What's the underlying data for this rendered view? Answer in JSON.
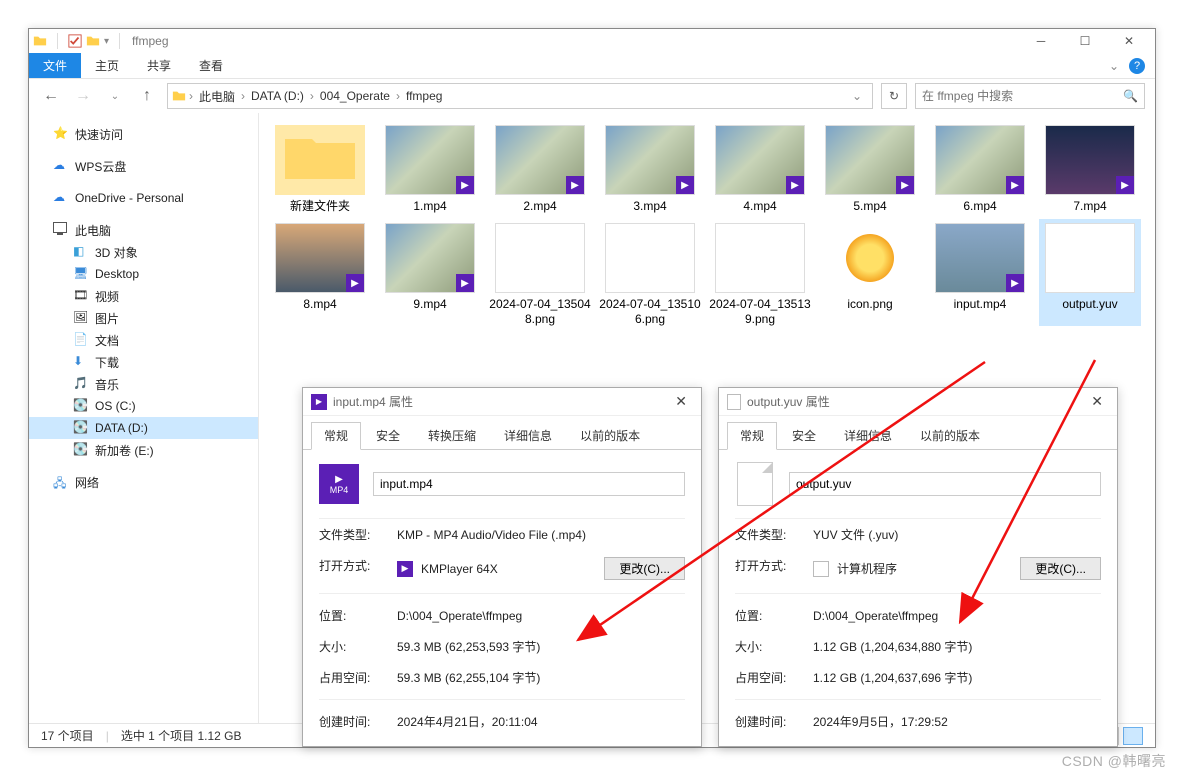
{
  "window": {
    "title": "ffmpeg"
  },
  "ribbon": {
    "file": "文件",
    "home": "主页",
    "share": "共享",
    "view": "查看"
  },
  "breadcrumb": {
    "this_pc": "此电脑",
    "drive": "DATA (D:)",
    "folder1": "004_Operate",
    "folder2": "ffmpeg"
  },
  "search": {
    "placeholder": "在 ffmpeg 中搜索"
  },
  "sidebar": {
    "quick": "快速访问",
    "wps": "WPS云盘",
    "onedrive": "OneDrive - Personal",
    "this_pc": "此电脑",
    "obj3d": "3D 对象",
    "desktop": "Desktop",
    "videos": "视频",
    "pictures": "图片",
    "documents": "文档",
    "downloads": "下载",
    "music": "音乐",
    "os_c": "OS (C:)",
    "data_d": "DATA (D:)",
    "new_e": "新加卷 (E:)",
    "network": "网络"
  },
  "files": {
    "new_folder": "新建文件夹",
    "f1": "1.mp4",
    "f2": "2.mp4",
    "f3": "3.mp4",
    "f4": "4.mp4",
    "f5": "5.mp4",
    "f6": "6.mp4",
    "f7": "7.mp4",
    "f8": "8.mp4",
    "f9": "9.mp4",
    "p1": "2024-07-04_135048.png",
    "p2": "2024-07-04_135106.png",
    "p3": "2024-07-04_135139.png",
    "icon": "icon.png",
    "input": "input.mp4",
    "output": "output.yuv"
  },
  "status": {
    "count": "17 个项目",
    "selected": "选中 1 个项目  1.12 GB"
  },
  "prop_input": {
    "title": "input.mp4 属性",
    "tabs": {
      "general": "常规",
      "security": "安全",
      "compress": "转换压缩",
      "details": "详细信息",
      "prev": "以前的版本"
    },
    "filename": "input.mp4",
    "type_k": "文件类型:",
    "type_v": "KMP - MP4 Audio/Video File (.mp4)",
    "open_k": "打开方式:",
    "open_v": "KMPlayer 64X",
    "change": "更改(C)...",
    "loc_k": "位置:",
    "loc_v": "D:\\004_Operate\\ffmpeg",
    "size_k": "大小:",
    "size_v": "59.3 MB (62,253,593 字节)",
    "disk_k": "占用空间:",
    "disk_v": "59.3 MB (62,255,104 字节)",
    "created_k": "创建时间:",
    "created_v": "2024年4月21日，20:11:04"
  },
  "prop_output": {
    "title": "output.yuv 属性",
    "tabs": {
      "general": "常规",
      "security": "安全",
      "details": "详细信息",
      "prev": "以前的版本"
    },
    "filename": "output.yuv",
    "type_k": "文件类型:",
    "type_v": "YUV 文件 (.yuv)",
    "open_k": "打开方式:",
    "open_v": "计算机程序",
    "change": "更改(C)...",
    "loc_k": "位置:",
    "loc_v": "D:\\004_Operate\\ffmpeg",
    "size_k": "大小:",
    "size_v": "1.12 GB (1,204,634,880 字节)",
    "disk_k": "占用空间:",
    "disk_v": "1.12 GB (1,204,637,696 字节)",
    "created_k": "创建时间:",
    "created_v": "2024年9月5日，17:29:52"
  },
  "watermark": "CSDN @韩曙亮"
}
